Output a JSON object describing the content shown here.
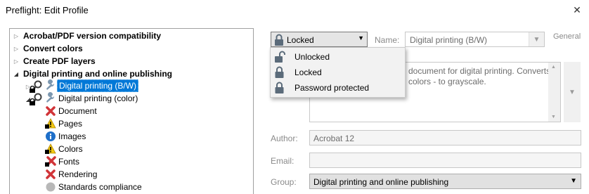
{
  "window": {
    "title": "Preflight: Edit Profile",
    "close_glyph": "✕"
  },
  "tree": {
    "items": [
      {
        "label": "Acrobat/PDF version compatibility",
        "expanded": false,
        "bold": true
      },
      {
        "label": "Convert colors",
        "expanded": false,
        "bold": true
      },
      {
        "label": "Create PDF layers",
        "expanded": false,
        "bold": true
      },
      {
        "label": "Digital printing and online publishing",
        "expanded": true,
        "bold": true
      },
      {
        "label": "Digital printing (B/W)",
        "selected": true,
        "icons": [
          "lock-icon",
          "magnifier-icon",
          "wrench-icon"
        ]
      },
      {
        "label": "Digital printing (color)",
        "expanded": true,
        "icons": [
          "lock-icon",
          "magnifier-icon",
          "wrench-icon"
        ]
      },
      {
        "label": "Document",
        "icon": "red-x-icon"
      },
      {
        "label": "Pages",
        "icon": "warning-lock-icon"
      },
      {
        "label": "Images",
        "icon": "info-icon"
      },
      {
        "label": "Colors",
        "icon": "warning-lock-icon"
      },
      {
        "label": "Fonts",
        "icon": "red-x-lock-icon"
      },
      {
        "label": "Rendering",
        "icon": "red-x-icon"
      },
      {
        "label": "Standards compliance",
        "icon": "gray-circle-icon"
      }
    ]
  },
  "lock_combo": {
    "value": "Locked",
    "options": [
      "Unlocked",
      "Locked",
      "Password protected"
    ]
  },
  "name": {
    "label": "Name:",
    "value": "Digital printing (B/W)"
  },
  "general_label": "General",
  "description": {
    "text": "document for digital printing. Converts colors - to grayscale."
  },
  "author": {
    "label": "Author:",
    "value": "Acrobat 12"
  },
  "email": {
    "label": "Email:",
    "value": ""
  },
  "group": {
    "label": "Group:",
    "value": "Digital printing and online publishing"
  },
  "colors": {
    "selection": "#0078d7",
    "error_red": "#d13438",
    "warning_yellow": "#f2c811",
    "info_blue": "#1e6fc9",
    "lock_gray": "#5b6b7a"
  }
}
